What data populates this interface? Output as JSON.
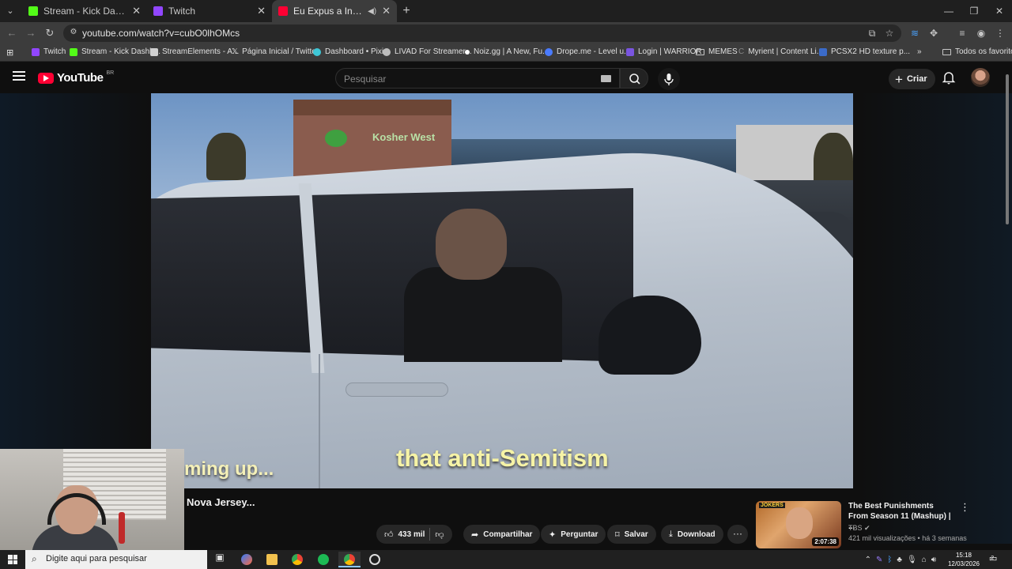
{
  "browser": {
    "tabs": [
      {
        "title": "Stream - Kick Dashboard",
        "favicon_color": "#53fc18",
        "active": false
      },
      {
        "title": "Twitch",
        "favicon_color": "#9146ff",
        "active": false
      },
      {
        "title": "Eu Expus a Invasão Judaica",
        "favicon_color": "#ff0033",
        "active": true
      }
    ],
    "address": "youtube.com/watch?v=cubO0lhOMcs",
    "bookmarks": [
      {
        "label": "Twitch",
        "color": "#9146ff"
      },
      {
        "label": "Stream - Kick Dashb...",
        "color": "#53fc18"
      },
      {
        "label": "StreamElements - A...",
        "color": "#d0d0d0"
      },
      {
        "label": "Página Inicial / Twitter",
        "color": "#e0e0e0"
      },
      {
        "label": "Dashboard • Pixie",
        "color": "#3ec6d6"
      },
      {
        "label": "LIVAD For Streamer...",
        "color": "#bdbdbd"
      },
      {
        "label": "Noiz.gg | A New, Fu...",
        "color": "#ffffff"
      },
      {
        "label": "Drope.me - Level u...",
        "color": "#4a7bff"
      },
      {
        "label": "Login | WARRIOR",
        "color": "#7a55e0"
      },
      {
        "label": "MEMES",
        "color": "folder"
      },
      {
        "label": "Myrient | Content Li...",
        "color": "#888888"
      },
      {
        "label": "PCSX2 HD texture p...",
        "color": "#3b6bc9"
      }
    ],
    "bookmarks_overflow": "»",
    "all_bookmarks": "Todos os favoritos"
  },
  "youtube": {
    "logo_text": "YouTube",
    "region": "BR",
    "search_placeholder": "Pesquisar",
    "create_label": "Criar",
    "video": {
      "caption_left": "ming up...",
      "caption_main": "that anti-Semitism",
      "store_sign": "Kosher West"
    },
    "title_fragment": "Nova Jersey...",
    "actions": {
      "likes": "433 mil",
      "share": "Compartilhar",
      "ask": "Perguntar",
      "save": "Salvar",
      "download": "Download",
      "more": "···"
    },
    "recommendation": {
      "title": "The Best Punishments From Season 11 (Mashup) | ...",
      "channel": "TBS",
      "meta": "421 mil visualizações • há 3 semanas",
      "duration": "2:07:38",
      "thumb_brand": "JOKERS"
    }
  },
  "taskbar": {
    "search_placeholder": "Digite aqui para pesquisar",
    "time": "15:18",
    "date": "12/03/2026",
    "notification_count": "2"
  }
}
